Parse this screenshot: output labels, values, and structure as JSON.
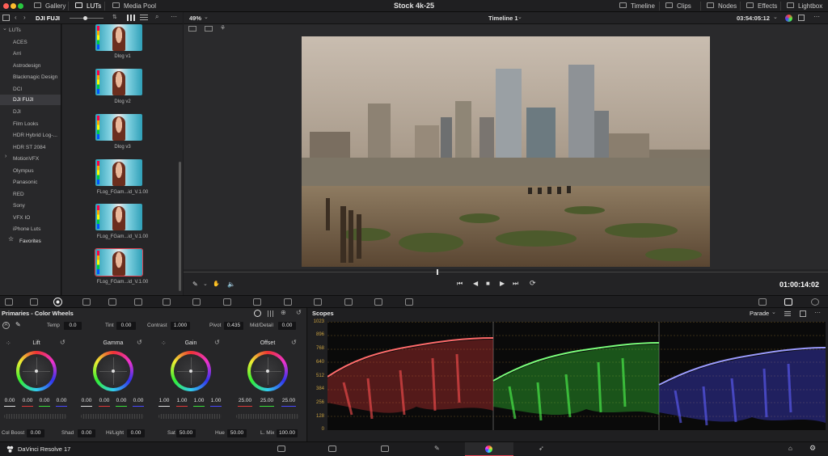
{
  "titlebar": {
    "project_title": "Stock 4k-25",
    "left_tabs": [
      {
        "label": "Gallery",
        "icon": "gallery-icon"
      },
      {
        "label": "LUTs",
        "icon": "luts-icon"
      },
      {
        "label": "Media Pool",
        "icon": "media-pool-icon"
      }
    ],
    "right_tabs": [
      {
        "label": "Timeline",
        "icon": "timeline-icon"
      },
      {
        "label": "Clips",
        "icon": "clips-icon"
      },
      {
        "label": "Nodes",
        "icon": "nodes-icon"
      },
      {
        "label": "Effects",
        "icon": "effects-icon"
      },
      {
        "label": "Lightbox",
        "icon": "lightbox-icon"
      }
    ]
  },
  "lut_browser": {
    "current_folder": "DJI FUJI",
    "tree": [
      {
        "label": "LUTs",
        "expanded": true
      },
      {
        "label": "ACES"
      },
      {
        "label": "Arri"
      },
      {
        "label": "Astrodesign"
      },
      {
        "label": "Blackmagic Design"
      },
      {
        "label": "DCI"
      },
      {
        "label": "DJI FUJI",
        "selected": true
      },
      {
        "label": "DJI"
      },
      {
        "label": "Film Looks"
      },
      {
        "label": "HDR Hybrid Log-..."
      },
      {
        "label": "HDR ST 2084"
      },
      {
        "label": "MotionVFX",
        "collapsed": true
      },
      {
        "label": "Olympus"
      },
      {
        "label": "Panasonic"
      },
      {
        "label": "RED"
      },
      {
        "label": "Sony"
      },
      {
        "label": "VFX IO"
      },
      {
        "label": "iPhone Luts"
      },
      {
        "label": "Favorites",
        "icon": "star-icon"
      }
    ],
    "thumbnails": [
      {
        "label": "Dlog v1"
      },
      {
        "label": "Dlog v2"
      },
      {
        "label": "Dlog v3"
      },
      {
        "label": "FLog_FGam...id_V.1.00"
      },
      {
        "label": "FLog_FGam...id_V.1.00"
      },
      {
        "label": "FLog_FGam...id_V.1.00",
        "selected": true
      }
    ]
  },
  "viewer": {
    "zoom": "49%",
    "timeline_name": "Timeline 1",
    "timecode_top": "03:54:05:12",
    "timecode": "01:00:14:02"
  },
  "primaries": {
    "title": "Primaries - Color Wheels",
    "temp_label": "Temp",
    "temp": "0.0",
    "tint_label": "Tint",
    "tint": "0.00",
    "contrast_label": "Contrast",
    "contrast": "1.000",
    "pivot_label": "Pivot",
    "pivot": "0.435",
    "middetail_label": "Mid/Detail",
    "middetail": "0.00",
    "wheels": [
      {
        "label": "Lift",
        "values": [
          "0.00",
          "0.00",
          "0.00",
          "0.00"
        ]
      },
      {
        "label": "Gamma",
        "values": [
          "0.00",
          "0.00",
          "0.00",
          "0.00"
        ]
      },
      {
        "label": "Gain",
        "values": [
          "1.00",
          "1.00",
          "1.00",
          "1.00"
        ]
      },
      {
        "label": "Offset",
        "values": [
          "25.00",
          "25.00",
          "25.00"
        ]
      }
    ],
    "colboost_label": "Col Boost",
    "colboost": "0.00",
    "shad_label": "Shad",
    "shad": "0.00",
    "hilight_label": "Hi/Light",
    "hilight": "0.00",
    "sat_label": "Sat",
    "sat": "50.00",
    "hue_label": "Hue",
    "hue": "50.00",
    "lmix_label": "L. Mix",
    "lmix": "100.00"
  },
  "scopes": {
    "title": "Scopes",
    "mode": "Parade",
    "y_labels": [
      "1023",
      "896",
      "768",
      "640",
      "512",
      "384",
      "256",
      "128",
      "0"
    ]
  },
  "bottombar": {
    "app_name": "DaVinci Resolve 17"
  },
  "colors": {
    "accent": "#e04050",
    "red_channel": "#e03a3a",
    "green_channel": "#3ae03a",
    "blue_channel": "#4a4aff"
  }
}
